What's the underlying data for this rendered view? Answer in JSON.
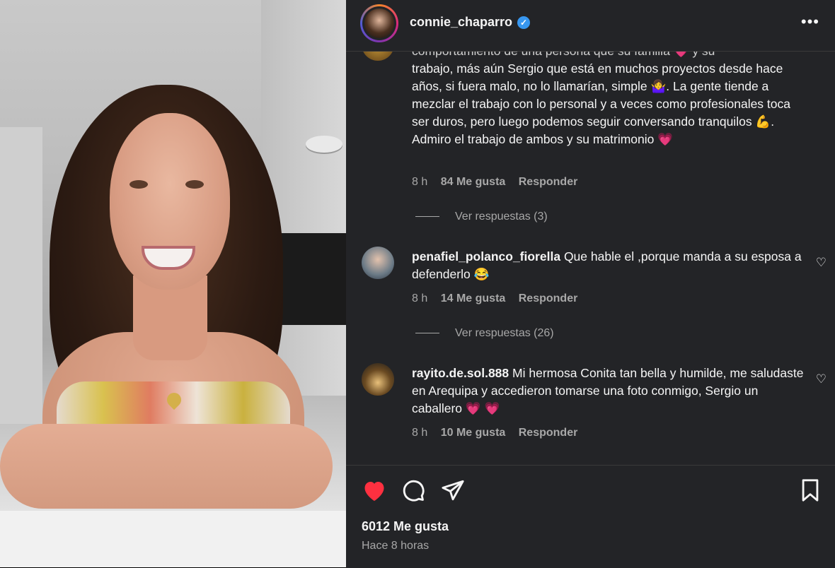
{
  "post": {
    "username": "connie_chaparro",
    "verified": true,
    "more_icon": "more-horizontal-icon"
  },
  "comments": [
    {
      "text_cut": "comportamiento de una persona que su familia 💗 y su",
      "text": "trabajo, más aún Sergio que está en muchos proyectos desde hace años, si fuera malo, no lo llamarían, simple 🤷‍♀️. La gente tiende a mezclar el trabajo con lo personal y a veces como profesionales toca ser duros, pero luego podemos seguir conversando tranquilos 💪. Admiro el trabajo de ambos y su matrimonio 💗",
      "time": "8 h",
      "likes": "84 Me gusta",
      "reply": "Responder",
      "view_replies": "Ver respuestas (3)"
    },
    {
      "user": "penafiel_polanco_fiorella",
      "text": "Que hable el ,porque manda a su esposa a defenderlo 😂",
      "time": "8 h",
      "likes": "14 Me gusta",
      "reply": "Responder",
      "view_replies": "Ver respuestas (26)"
    },
    {
      "user": "rayito.de.sol.888",
      "text": "Mi hermosa Conita tan bella y humilde, me saludaste en Arequipa y accedieron tomarse una foto conmigo, Sergio un caballero 💗 💗",
      "time": "8 h",
      "likes": "10 Me gusta",
      "reply": "Responder"
    }
  ],
  "actions": {
    "like_icon": "heart-filled-icon",
    "comment_icon": "comment-icon",
    "share_icon": "share-icon",
    "save_icon": "bookmark-icon",
    "liked": true,
    "like_color": "#ff3040"
  },
  "footer": {
    "likes": "6012 Me gusta",
    "time": "Hace 8 horas"
  }
}
